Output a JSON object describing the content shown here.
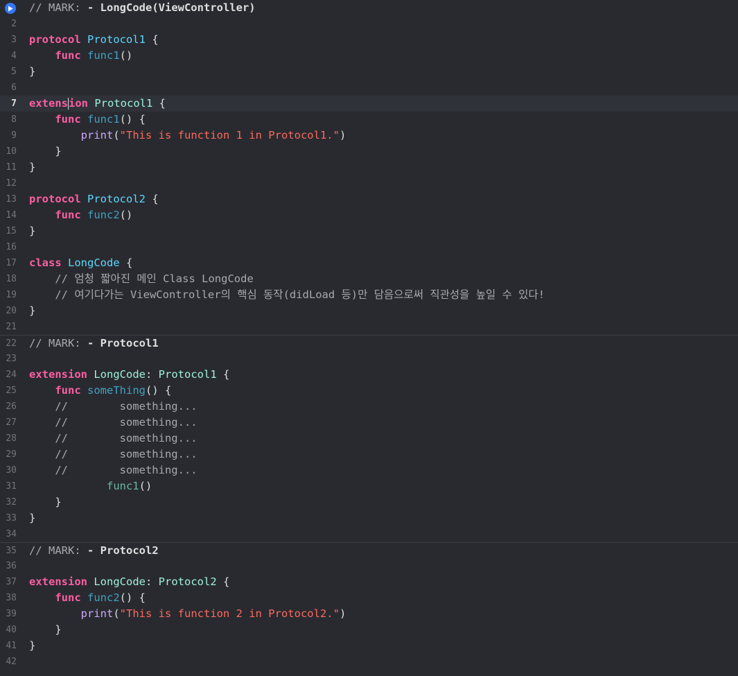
{
  "editor": {
    "run_icon": "play-icon",
    "current_line": 7,
    "lines": [
      {
        "num": "1",
        "tokens": [
          {
            "c": "markhead",
            "t": "// MARK: "
          },
          {
            "c": "markbold",
            "t": "- LongCode(ViewController)"
          }
        ]
      },
      {
        "num": "2",
        "tokens": []
      },
      {
        "num": "3",
        "tokens": [
          {
            "c": "kw",
            "t": "protocol"
          },
          {
            "c": "plain",
            "t": " "
          },
          {
            "c": "type",
            "t": "Protocol1"
          },
          {
            "c": "plain",
            "t": " {"
          }
        ]
      },
      {
        "num": "4",
        "tokens": [
          {
            "c": "plain",
            "t": "    "
          },
          {
            "c": "kw",
            "t": "func"
          },
          {
            "c": "plain",
            "t": " "
          },
          {
            "c": "decl",
            "t": "func1"
          },
          {
            "c": "plain",
            "t": "()"
          }
        ]
      },
      {
        "num": "5",
        "tokens": [
          {
            "c": "plain",
            "t": "}"
          }
        ]
      },
      {
        "num": "6",
        "tokens": []
      },
      {
        "num": "7",
        "tokens": [
          {
            "c": "kw",
            "t": "extens"
          },
          {
            "c": "cursor",
            "t": ""
          },
          {
            "c": "kw",
            "t": "ion"
          },
          {
            "c": "plain",
            "t": " "
          },
          {
            "c": "ptype",
            "t": "Protocol1"
          },
          {
            "c": "plain",
            "t": " {"
          }
        ]
      },
      {
        "num": "8",
        "tokens": [
          {
            "c": "plain",
            "t": "    "
          },
          {
            "c": "kw",
            "t": "func"
          },
          {
            "c": "plain",
            "t": " "
          },
          {
            "c": "decl",
            "t": "func1"
          },
          {
            "c": "plain",
            "t": "() {"
          }
        ]
      },
      {
        "num": "9",
        "tokens": [
          {
            "c": "plain",
            "t": "        "
          },
          {
            "c": "lib",
            "t": "print"
          },
          {
            "c": "plain",
            "t": "("
          },
          {
            "c": "str",
            "t": "\"This is function 1 in Protocol1.\""
          },
          {
            "c": "plain",
            "t": ")"
          }
        ]
      },
      {
        "num": "10",
        "tokens": [
          {
            "c": "plain",
            "t": "    }"
          }
        ]
      },
      {
        "num": "11",
        "tokens": [
          {
            "c": "plain",
            "t": "}"
          }
        ]
      },
      {
        "num": "12",
        "tokens": []
      },
      {
        "num": "13",
        "tokens": [
          {
            "c": "kw",
            "t": "protocol"
          },
          {
            "c": "plain",
            "t": " "
          },
          {
            "c": "type",
            "t": "Protocol2"
          },
          {
            "c": "plain",
            "t": " {"
          }
        ]
      },
      {
        "num": "14",
        "tokens": [
          {
            "c": "plain",
            "t": "    "
          },
          {
            "c": "kw",
            "t": "func"
          },
          {
            "c": "plain",
            "t": " "
          },
          {
            "c": "decl",
            "t": "func2"
          },
          {
            "c": "plain",
            "t": "()"
          }
        ]
      },
      {
        "num": "15",
        "tokens": [
          {
            "c": "plain",
            "t": "}"
          }
        ]
      },
      {
        "num": "16",
        "tokens": []
      },
      {
        "num": "17",
        "tokens": [
          {
            "c": "kw",
            "t": "class"
          },
          {
            "c": "plain",
            "t": " "
          },
          {
            "c": "type",
            "t": "LongCode"
          },
          {
            "c": "plain",
            "t": " {"
          }
        ]
      },
      {
        "num": "18",
        "tokens": [
          {
            "c": "plain",
            "t": "    "
          },
          {
            "c": "cmt",
            "t": "// 엄청 짧아진 메인 Class LongCode"
          }
        ]
      },
      {
        "num": "19",
        "tokens": [
          {
            "c": "plain",
            "t": "    "
          },
          {
            "c": "cmt",
            "t": "// 여기다가는 ViewController의 핵심 동작(didLoad 등)만 담음으로써 직관성을 높일 수 있다!"
          }
        ]
      },
      {
        "num": "20",
        "tokens": [
          {
            "c": "plain",
            "t": "}"
          }
        ]
      },
      {
        "num": "21",
        "tokens": []
      },
      {
        "num": "22",
        "mark": true,
        "tokens": [
          {
            "c": "markhead",
            "t": "// MARK: "
          },
          {
            "c": "markbold",
            "t": "- Protocol1"
          }
        ]
      },
      {
        "num": "23",
        "tokens": []
      },
      {
        "num": "24",
        "tokens": [
          {
            "c": "kw",
            "t": "extension"
          },
          {
            "c": "plain",
            "t": " "
          },
          {
            "c": "ptype",
            "t": "LongCode"
          },
          {
            "c": "plain",
            "t": ": "
          },
          {
            "c": "ptype",
            "t": "Protocol1"
          },
          {
            "c": "plain",
            "t": " {"
          }
        ]
      },
      {
        "num": "25",
        "tokens": [
          {
            "c": "plain",
            "t": "    "
          },
          {
            "c": "kw",
            "t": "func"
          },
          {
            "c": "plain",
            "t": " "
          },
          {
            "c": "decl",
            "t": "someThing"
          },
          {
            "c": "plain",
            "t": "() {"
          }
        ]
      },
      {
        "num": "26",
        "tokens": [
          {
            "c": "plain",
            "t": "    "
          },
          {
            "c": "cmt",
            "t": "//        something..."
          }
        ]
      },
      {
        "num": "27",
        "tokens": [
          {
            "c": "plain",
            "t": "    "
          },
          {
            "c": "cmt",
            "t": "//        something..."
          }
        ]
      },
      {
        "num": "28",
        "tokens": [
          {
            "c": "plain",
            "t": "    "
          },
          {
            "c": "cmt",
            "t": "//        something..."
          }
        ]
      },
      {
        "num": "29",
        "tokens": [
          {
            "c": "plain",
            "t": "    "
          },
          {
            "c": "cmt",
            "t": "//        something..."
          }
        ]
      },
      {
        "num": "30",
        "tokens": [
          {
            "c": "plain",
            "t": "    "
          },
          {
            "c": "cmt",
            "t": "//        something..."
          }
        ]
      },
      {
        "num": "31",
        "tokens": [
          {
            "c": "plain",
            "t": "            "
          },
          {
            "c": "fn",
            "t": "func1"
          },
          {
            "c": "plain",
            "t": "()"
          }
        ]
      },
      {
        "num": "32",
        "tokens": [
          {
            "c": "plain",
            "t": "    }"
          }
        ]
      },
      {
        "num": "33",
        "tokens": [
          {
            "c": "plain",
            "t": "}"
          }
        ]
      },
      {
        "num": "34",
        "tokens": []
      },
      {
        "num": "35",
        "mark": true,
        "tokens": [
          {
            "c": "markhead",
            "t": "// MARK: "
          },
          {
            "c": "markbold",
            "t": "- Protocol2"
          }
        ]
      },
      {
        "num": "36",
        "tokens": []
      },
      {
        "num": "37",
        "tokens": [
          {
            "c": "kw",
            "t": "extension"
          },
          {
            "c": "plain",
            "t": " "
          },
          {
            "c": "ptype",
            "t": "LongCode"
          },
          {
            "c": "plain",
            "t": ": "
          },
          {
            "c": "ptype",
            "t": "Protocol2"
          },
          {
            "c": "plain",
            "t": " {"
          }
        ]
      },
      {
        "num": "38",
        "tokens": [
          {
            "c": "plain",
            "t": "    "
          },
          {
            "c": "kw",
            "t": "func"
          },
          {
            "c": "plain",
            "t": " "
          },
          {
            "c": "decl",
            "t": "func2"
          },
          {
            "c": "plain",
            "t": "() {"
          }
        ]
      },
      {
        "num": "39",
        "tokens": [
          {
            "c": "plain",
            "t": "        "
          },
          {
            "c": "lib",
            "t": "print"
          },
          {
            "c": "plain",
            "t": "("
          },
          {
            "c": "str",
            "t": "\"This is function 2 in Protocol2.\""
          },
          {
            "c": "plain",
            "t": ")"
          }
        ]
      },
      {
        "num": "40",
        "tokens": [
          {
            "c": "plain",
            "t": "    }"
          }
        ]
      },
      {
        "num": "41",
        "tokens": [
          {
            "c": "plain",
            "t": "}"
          }
        ]
      },
      {
        "num": "42",
        "tokens": []
      }
    ]
  }
}
